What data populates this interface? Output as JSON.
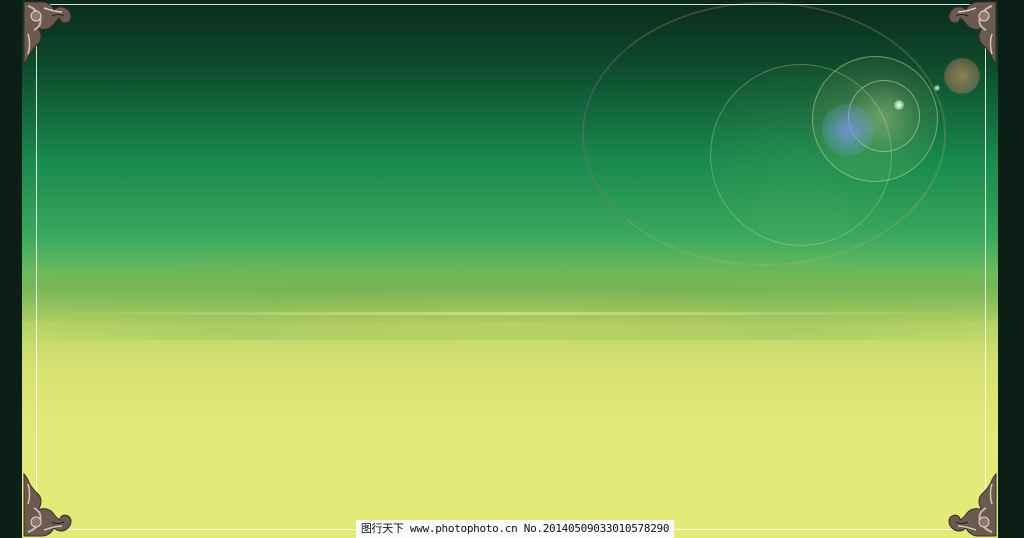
{
  "watermark": {
    "text": "图行天下 www.photophoto.cn  No.20140509033010578290"
  },
  "colors": {
    "border_dark": "#0b1f16",
    "sky_top": "#0b2a1c",
    "sky_green": "#198a4d",
    "ground_yellow": "#e2ea78",
    "frame_line": "#ffffff"
  },
  "icons": {
    "corner_ornament": "ornate-corner-icon"
  }
}
